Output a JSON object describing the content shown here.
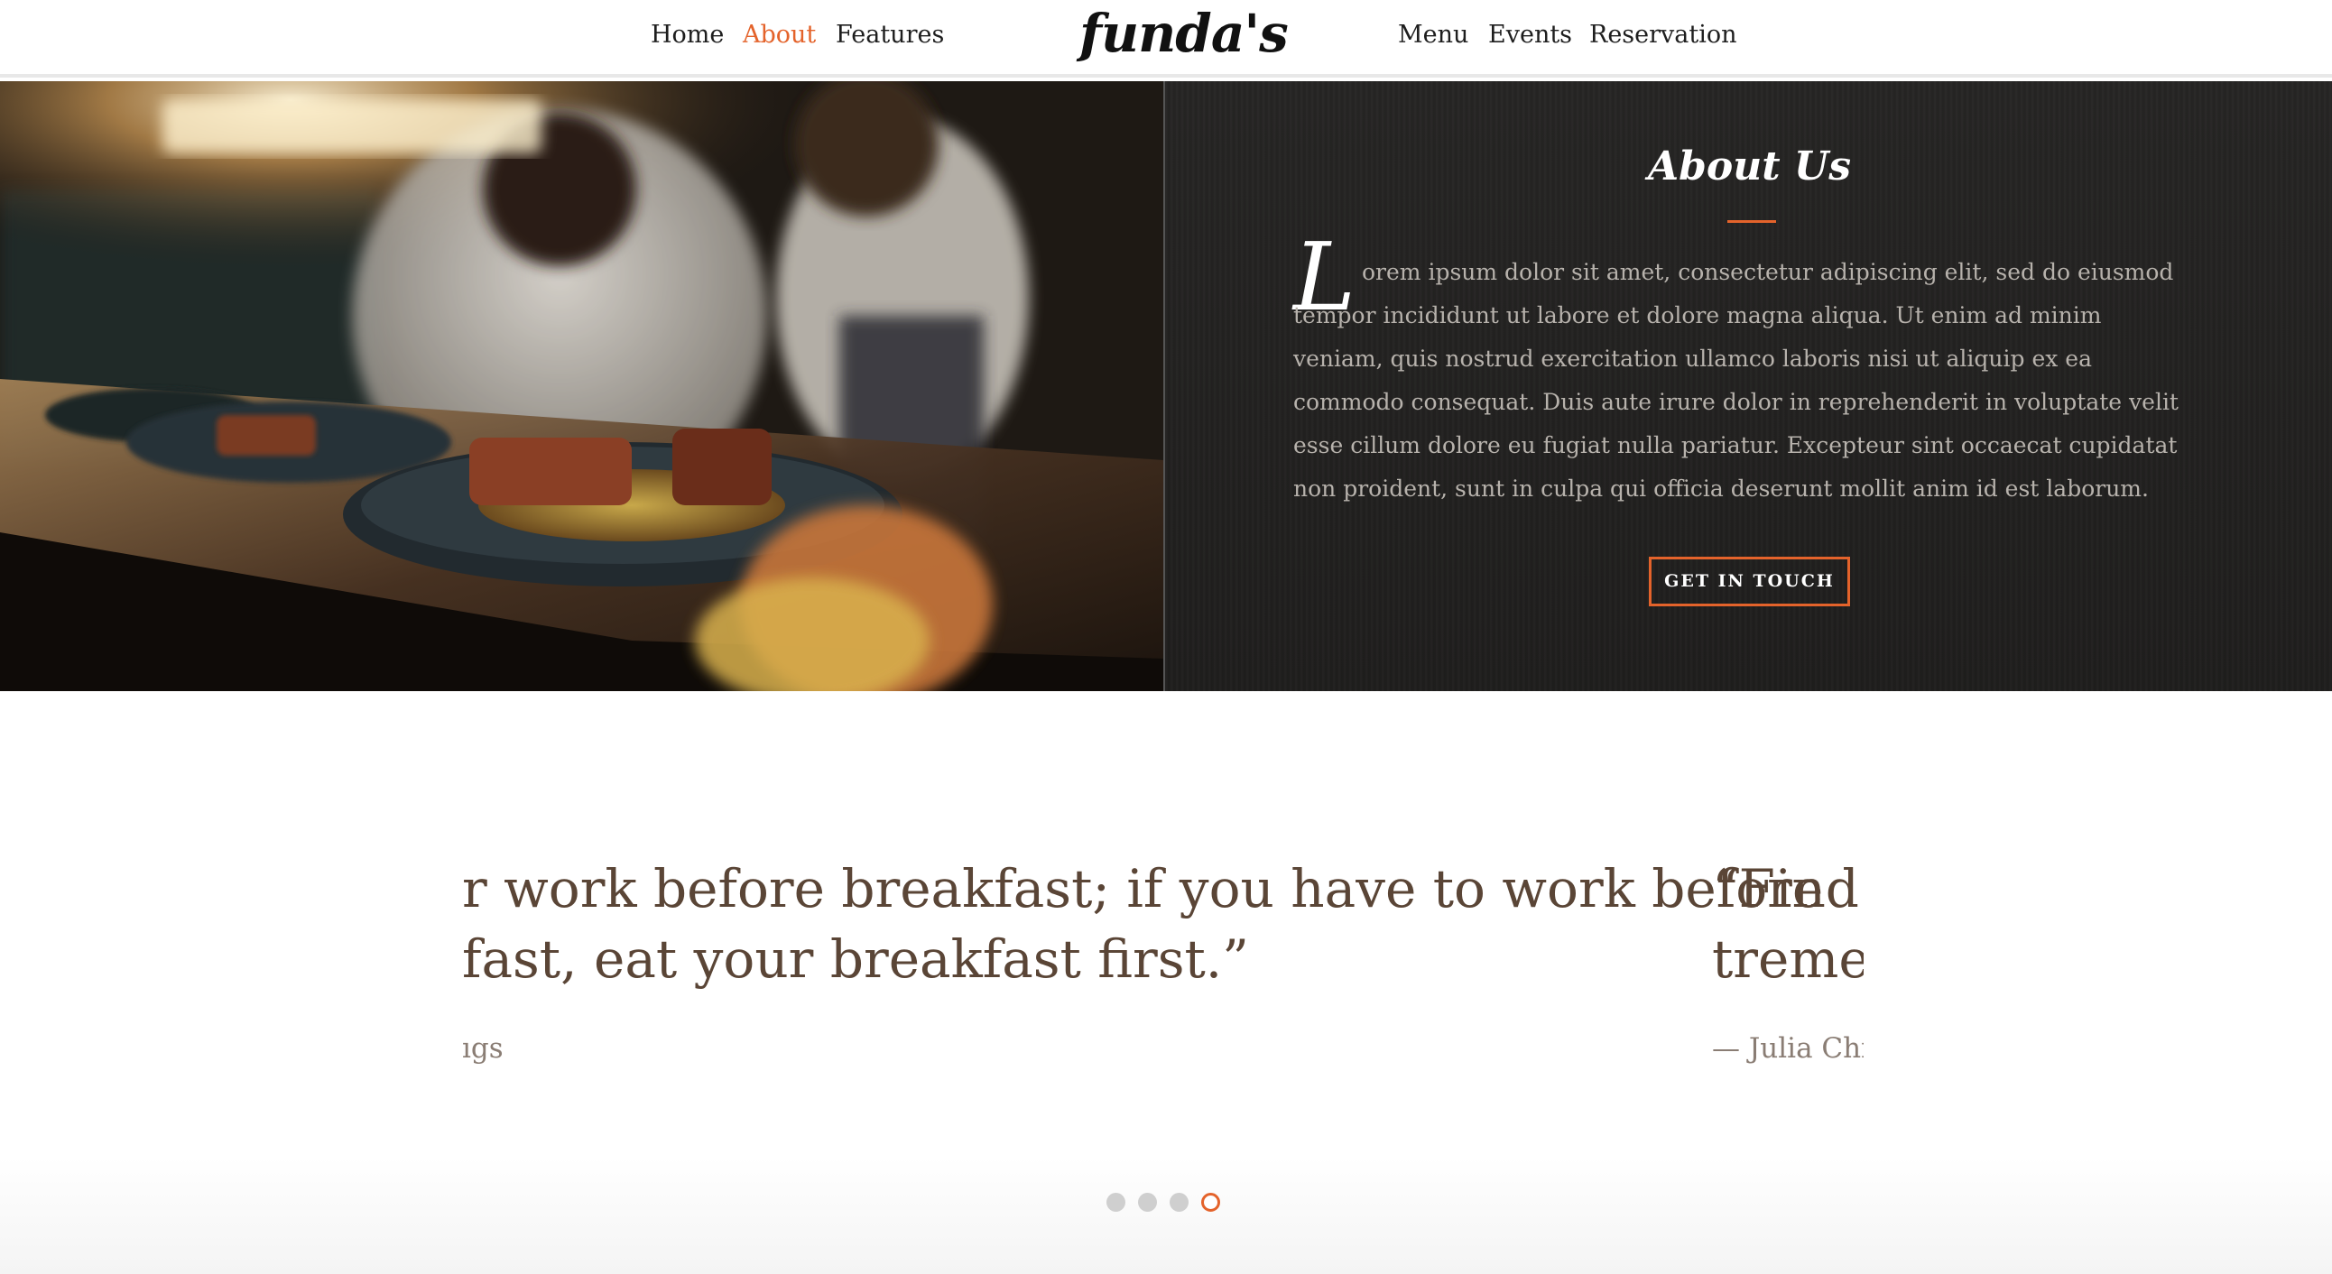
{
  "nav": {
    "left": [
      {
        "label": "Home",
        "active": false
      },
      {
        "label": "About",
        "active": true
      },
      {
        "label": "Features",
        "active": false
      }
    ],
    "logo": "funda's",
    "right": [
      {
        "label": "Menu",
        "active": false
      },
      {
        "label": "Events",
        "active": false
      },
      {
        "label": "Reservation",
        "active": false
      }
    ]
  },
  "about": {
    "title": "About Us",
    "drop_cap": "L",
    "body_line1": "orem ipsum dolor sit amet, consectetur adipiscing elit, sed do eiusmod tempor incididunt ut labore et dolore magna aliqua.",
    "body_rest": "Ut enim ad minim veniam, quis nostrud exercitation ullamco laboris nisi ut aliquip ex ea commodo consequat. Duis aute irure dolor in reprehenderit in voluptate velit esse cillum dolore eu fugiat nulla pariatur. Excepteur sint occaecat cupidatat non proident, sunt in culpa qui officia deserunt mollit anim id est laborum.",
    "cta_label": "GET IN TOUCH",
    "photo_alt": "restaurant-kitchen-plated-steak-photo"
  },
  "testimonials": {
    "slides": [
      {
        "line1": "r work before breakfast; if you have to work before",
        "line2": "fast, eat your breakfast first.”",
        "author": "ıgs"
      },
      {
        "line1": "“Find a",
        "line2": "tremen",
        "author": "— Julia Child"
      }
    ],
    "dots": [
      {
        "active": false
      },
      {
        "active": false
      },
      {
        "active": false
      },
      {
        "active": true
      }
    ]
  },
  "colors": {
    "accent": "#e4632b",
    "panel_bg": "#232221",
    "quote_text": "#5a4536"
  }
}
